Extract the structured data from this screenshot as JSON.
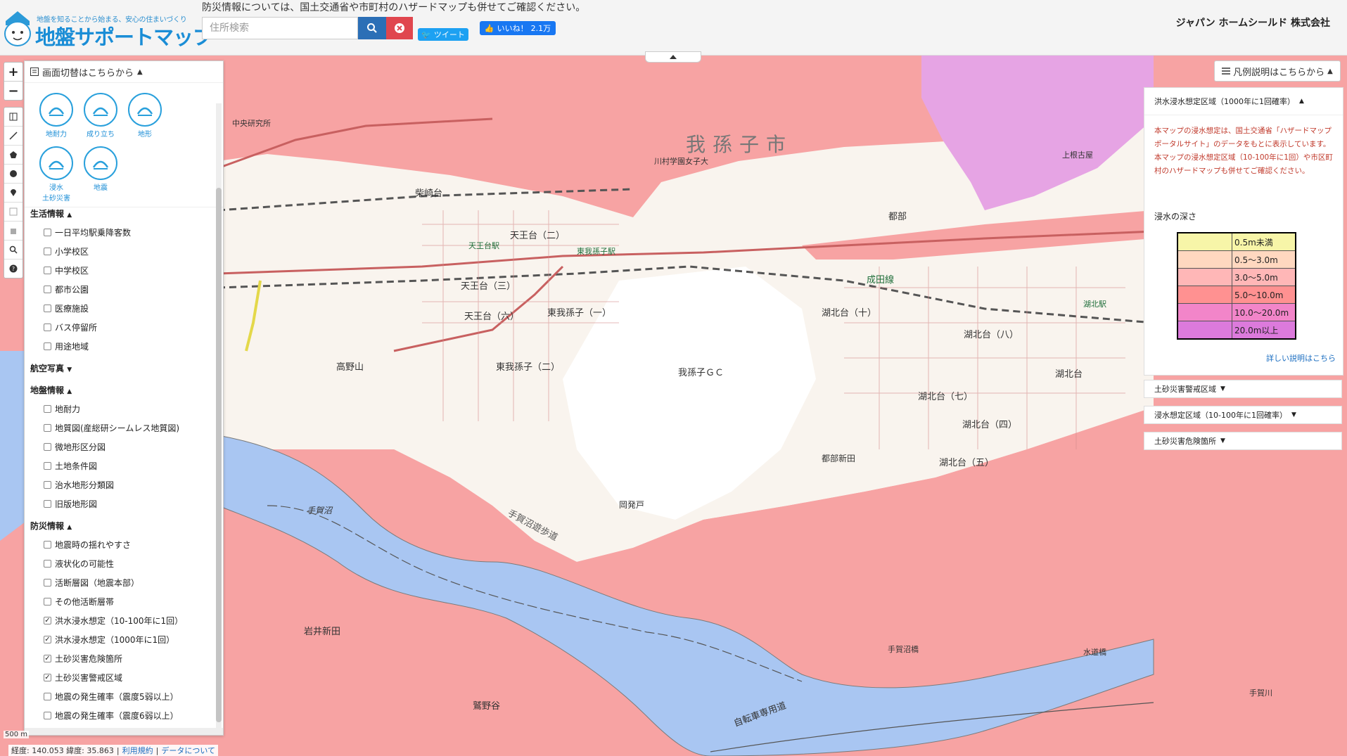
{
  "header": {
    "logo_tagline": "地盤を知ることから始まる、安心の住まいづくり",
    "logo_title": "地盤サポートマップ",
    "notice": "防災情報については、国土交通省や市町村のハザードマップも併せてご確認ください。",
    "search_placeholder": "住所検索",
    "tweet_label": "ツイート",
    "like_label": "いいね！",
    "like_count": "2.1万",
    "company": "ジャパン ホームシールド 株式会社"
  },
  "sidebar": {
    "head_label": "画面切替はこちらから",
    "modes": [
      {
        "label": "地耐力",
        "icon": "house-ground-icon"
      },
      {
        "label": "成り立ち",
        "icon": "history-clock-icon"
      },
      {
        "label": "地形",
        "icon": "terrain-icon"
      },
      {
        "label": "浸水\n土砂災害",
        "icon": "flood-icon"
      },
      {
        "label": "地震",
        "icon": "earthquake-icon"
      }
    ],
    "sections": [
      {
        "title": "生活情報",
        "arrow": "▲",
        "items": [
          {
            "label": "一日平均駅乗降客数",
            "checked": false
          },
          {
            "label": "小学校区",
            "checked": false
          },
          {
            "label": "中学校区",
            "checked": false
          },
          {
            "label": "都市公園",
            "checked": false
          },
          {
            "label": "医療施設",
            "checked": false
          },
          {
            "label": "バス停留所",
            "checked": false
          },
          {
            "label": "用途地域",
            "checked": false
          }
        ]
      },
      {
        "title": "航空写真",
        "arrow": "▼",
        "items": []
      },
      {
        "title": "地盤情報",
        "arrow": "▲",
        "items": [
          {
            "label": "地耐力",
            "checked": false
          },
          {
            "label": "地質図(産総研シームレス地質図)",
            "checked": false
          },
          {
            "label": "微地形区分図",
            "checked": false
          },
          {
            "label": "土地条件図",
            "checked": false
          },
          {
            "label": "治水地形分類図",
            "checked": false
          },
          {
            "label": "旧版地形図",
            "checked": false
          }
        ]
      },
      {
        "title": "防災情報",
        "arrow": "▲",
        "items": [
          {
            "label": "地震時の揺れやすさ",
            "checked": false
          },
          {
            "label": "液状化の可能性",
            "checked": false
          },
          {
            "label": "活断層図（地震本部）",
            "checked": false
          },
          {
            "label": "その他活断層帯",
            "checked": false
          },
          {
            "label": "洪水浸水想定（10-100年に1回）",
            "checked": true
          },
          {
            "label": "洪水浸水想定（1000年に1回）",
            "checked": true
          },
          {
            "label": "土砂災害危険箇所",
            "checked": true
          },
          {
            "label": "土砂災害警戒区域",
            "checked": true
          },
          {
            "label": "地震の発生確率（震度5弱以上）",
            "checked": false
          },
          {
            "label": "地震の発生確率（震度6弱以上）",
            "checked": false
          }
        ]
      }
    ]
  },
  "legend": {
    "toggle_label": "凡例説明はこちらから",
    "title": "洪水浸水想定区域（1000年に1回確率）",
    "desc1": "本マップの浸水想定は、国土交通省「ハザードマップポータルサイト」のデータをもとに表示しています。",
    "desc2": "本マップの浸水想定区域（10-100年に1回）や市区町村のハザードマップも併せてご確認ください。",
    "depth_label": "浸水の深さ",
    "depths": [
      {
        "label": "0.5m未満",
        "color": "#f7f5a8"
      },
      {
        "label": "0.5～3.0m",
        "color": "#ffd8c0"
      },
      {
        "label": "3.0～5.0m",
        "color": "#ffb7b7"
      },
      {
        "label": "5.0～10.0m",
        "color": "#ff9191"
      },
      {
        "label": "10.0～20.0m",
        "color": "#f285c9"
      },
      {
        "label": "20.0m以上",
        "color": "#dc7adc"
      }
    ],
    "more_label": "詳しい説明はこちら",
    "collapsed": [
      {
        "label": "土砂災害警戒区域"
      },
      {
        "label": "浸水想定区域（10-100年に1回確率）"
      },
      {
        "label": "土砂災害危険箇所"
      }
    ]
  },
  "map": {
    "labels": {
      "city": "我孫子市",
      "golf": "我孫子ＧＣ",
      "lake": "手賀沼",
      "trail": "手賀沼遊歩道",
      "bike": "自転車専用道",
      "line": "成田線",
      "station_abiko_e": "東我孫子駅",
      "station_tenno": "天王台駅",
      "station_kohoku": "湖北駅",
      "tennodai2": "天王台（二）",
      "tennodai3": "天王台（三）",
      "tennodai6": "天王台（六）",
      "higashi1": "東我孫子（一）",
      "higashi2": "東我孫子（二）",
      "shibasaki": "柴崎台",
      "takano": "高野山",
      "kohokudai10": "湖北台（十）",
      "kohokudai8": "湖北台（八）",
      "kohokudai7": "湖北台（七）",
      "kohokudai4": "湖北台（四）",
      "kohokudai5": "湖北台（五）",
      "kohokudai3": "湖北台",
      "toribe": "都部",
      "toribeshinden": "都部新田",
      "okahotto": "岡発戸",
      "iwai": "岩井新田",
      "washinoya": "鷲野谷",
      "tegawa": "手賀川",
      "suido": "水道橋",
      "tegabashi": "手賀沼橋",
      "kamine": "上根古屋",
      "kawamura": "川村学園女子大",
      "chuo": "中央研究所"
    }
  },
  "footer": {
    "coords": "経度: 140.053 緯度: 35.863",
    "terms": "利用規約",
    "about": "データについて",
    "scale": "500 m"
  }
}
